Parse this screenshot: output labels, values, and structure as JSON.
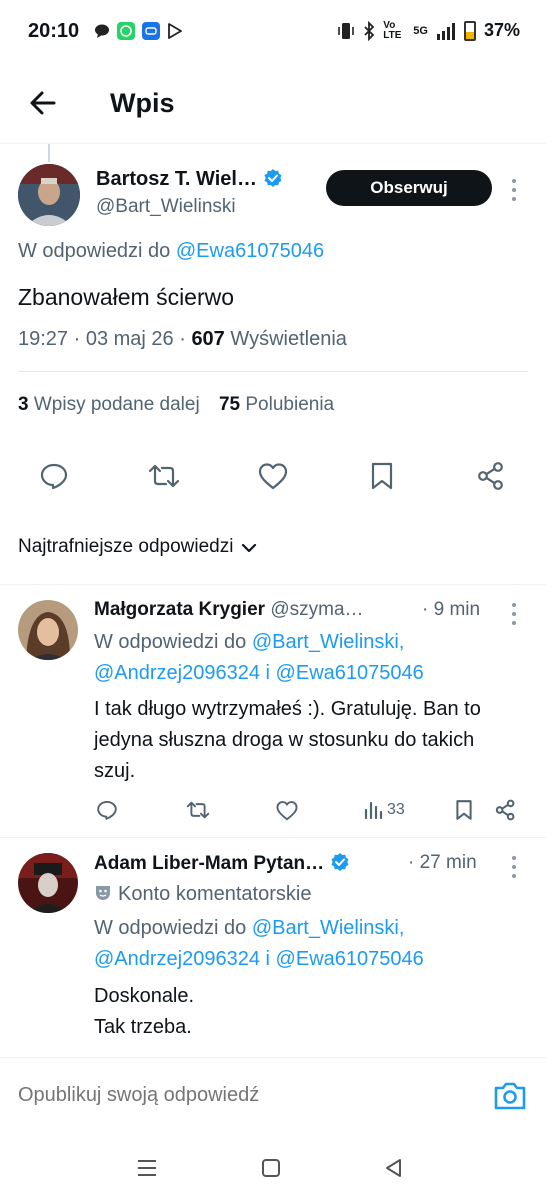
{
  "status_bar": {
    "time": "20:10",
    "battery": "37%",
    "network": "5G",
    "volte": "Vo LTE"
  },
  "header": {
    "title": "Wpis"
  },
  "main_tweet": {
    "author_name": "Bartosz T. Wiel…",
    "author_handle": "@Bart_Wielinski",
    "follow_label": "Obserwuj",
    "reply_to_prefix": "W odpowiedzi do",
    "reply_to_handle": "@Ewa61075046",
    "text": "Zbanowałem ścierwo",
    "timestamp": "19:27 · 03 maj 26 · ",
    "views_count": "607",
    "views_label": " Wyświetlenia",
    "reposts_count": "3",
    "reposts_label": " Wpisy podane dalej",
    "likes_count": "75",
    "likes_label": " Polubienia"
  },
  "sort_label": "Najtrafniejsze odpowiedzi",
  "replies": [
    {
      "name": "Małgorzata Krygier",
      "handle": "@szyma…",
      "time": "· 9 min",
      "reply_prefix": "W odpowiedzi do",
      "reply_handle_1": "@Bart_Wielinski,",
      "reply_handle_2": "@Andrzej2096324",
      "reply_and": " i ",
      "reply_handle_3": "@Ewa61075046",
      "text": "I tak długo wytrzymałeś :). Gratuluję. Ban to jedyna słuszna droga w stosunku do takich szuj.",
      "views": "33"
    },
    {
      "name": "Adam Liber-Mam Pytan…",
      "time": "· 27 min",
      "badge": "Konto komentatorskie",
      "reply_prefix": "W odpowiedzi do",
      "reply_handle_1": "@Bart_Wielinski,",
      "reply_handle_2": "@Andrzej2096324",
      "reply_and": " i ",
      "reply_handle_3": "@Ewa61075046",
      "text_line_1": "Doskonale.",
      "text_line_2": "Tak trzeba."
    }
  ],
  "composer": {
    "placeholder": "Opublikuj swoją odpowiedź"
  },
  "colors": {
    "accent": "#1d9bf0",
    "text": "#0f1419",
    "muted": "#536471",
    "follow_bg": "#0f1419"
  },
  "icons": [
    "back-arrow-icon",
    "verified-icon",
    "reply-icon",
    "repost-icon",
    "like-icon",
    "bookmark-icon",
    "share-icon",
    "views-icon",
    "camera-icon",
    "chevron-down-icon",
    "more-icon"
  ]
}
